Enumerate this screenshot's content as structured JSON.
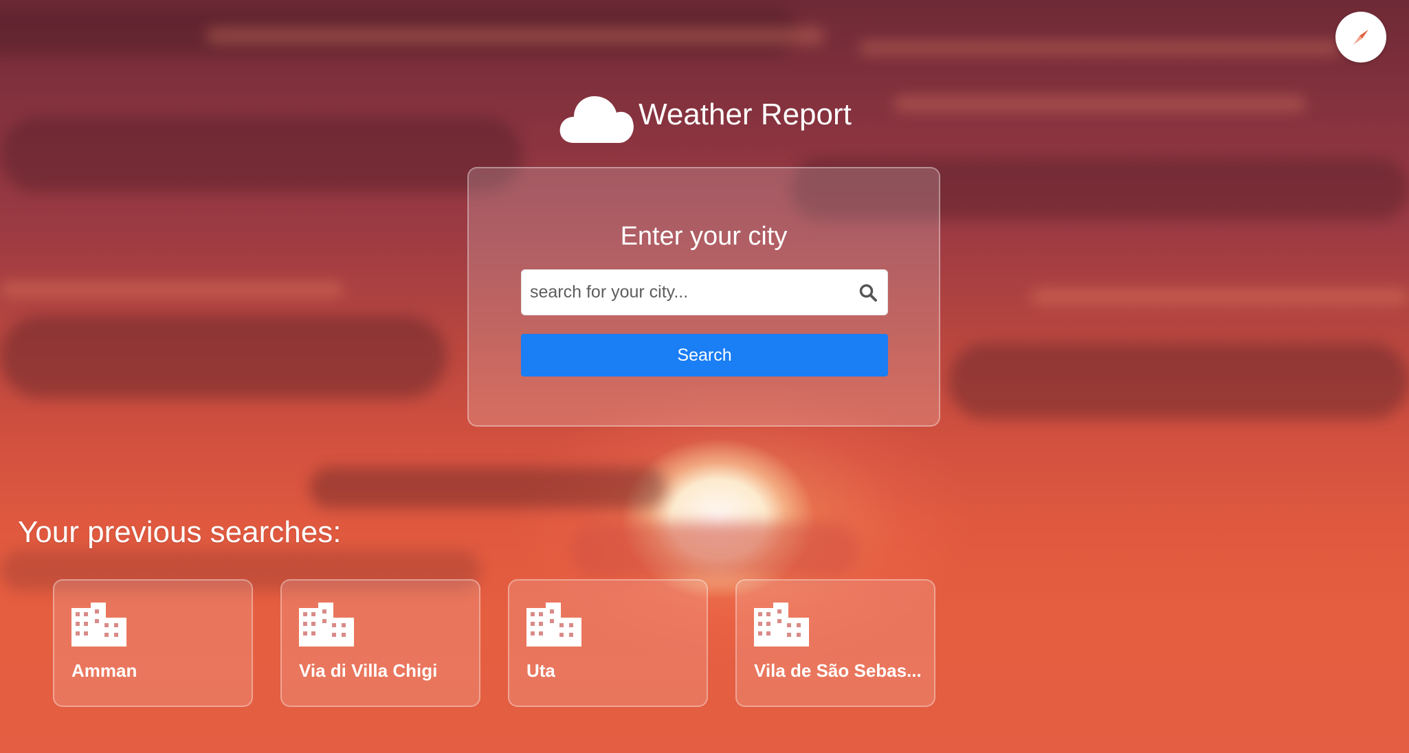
{
  "header": {
    "app_title": "Weather Report",
    "logo_icon": "cloud-icon",
    "corner_button_icon": "compass-icon"
  },
  "search": {
    "heading": "Enter your city",
    "placeholder": "search for your city...",
    "value": "",
    "search_icon": "search-icon",
    "button_label": "Search",
    "button_color": "#1a7ef5"
  },
  "previous_searches": {
    "heading": "Your previous searches:",
    "items": [
      {
        "label": "Amman",
        "icon": "city-buildings-icon"
      },
      {
        "label": "Via di Villa Chigi",
        "icon": "city-buildings-icon"
      },
      {
        "label": "Uta",
        "icon": "city-buildings-icon"
      },
      {
        "label": "Vila de São Sebas...",
        "icon": "city-buildings-icon"
      }
    ]
  }
}
